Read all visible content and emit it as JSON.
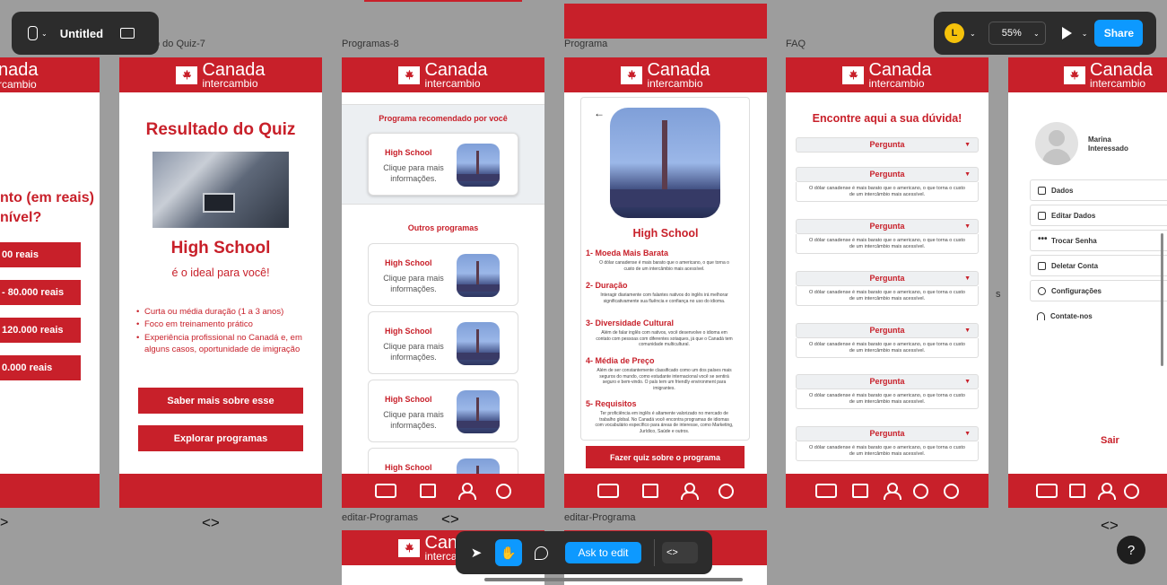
{
  "figma": {
    "file_name": "Untitled",
    "avatar_letter": "L",
    "zoom": "55%",
    "share_label": "Share",
    "ask_to_edit_label": "Ask to edit",
    "help_label": "?"
  },
  "frame_labels": {
    "quiz": "o do Quiz-7",
    "programas": "Programas-8",
    "programa": "Programa",
    "faq": "FAQ",
    "editar_programas": "editar-Programas",
    "editar_programa": "editar-Programa",
    "stray_s": "s"
  },
  "code_markers": {
    "m1": "<>",
    "m2": "<>",
    "m3": "<>",
    "m4": ">"
  },
  "logo": {
    "name": "Canada",
    "sub": "intercambio",
    "partial_name": "nada",
    "partial_sub": "rcambio"
  },
  "left_frame": {
    "question_line1": "nto (em reais)",
    "question_line2": "nível?",
    "options": [
      "00 reais",
      "- 80.000 reais",
      "120.000 reais",
      "0.000 reais"
    ]
  },
  "quiz_result": {
    "title": "Resultado do Quiz",
    "program": "High School",
    "subtitle": "é o ideal para você!",
    "bullets": [
      "Curta ou média duração (1 a 3 anos)",
      "Foco em treinamento prático",
      "Experiência profissional no Canadá e, em alguns casos, oportunidade de imigração"
    ],
    "btn_more": "Saber mais sobre esse",
    "btn_explore": "Explorar programas"
  },
  "programas": {
    "recommended_title": "Programa recomendado por você",
    "others_title": "Outros programas",
    "card_title": "High School",
    "card_desc": "Clique para mais informações."
  },
  "programa": {
    "title": "High School",
    "sections": [
      {
        "h": "1- Moeda Mais Barata",
        "t": "O dólar canadense é mais barato que o americano, o que torna o custo de um intercâmbio mais acessível."
      },
      {
        "h": "2- Duração",
        "t": "Interagir diariamente com falantes nativos do inglês irá melhorar significativamente sua fluência e confiança no uso do idioma."
      },
      {
        "h": "3- Diversidade Cultural",
        "t": "Além de falar inglês com nativos, você desenvolve o idioma em contato com pessoas com diferentes sotaques, já que o Canadá tem comunidade multicultural."
      },
      {
        "h": "4- Média de Preço",
        "t": "Além de ser constantemente classificado como um dos países mais seguros do mundo, como estudante internacional você se sentirá seguro e bem-vindo. O país tem um friendly environment para imigrantes."
      },
      {
        "h": "5- Requisitos",
        "t": "Ter proficiência em inglês é altamente valorizado no mercado de trabalho global. No Canadá você encontra programas de idiomas com vocabulário específico para áreas de interesse, como Marketing, Jurídico, Saúde e outros."
      }
    ],
    "btn": "Fazer quiz sobre o programa"
  },
  "faq": {
    "title": "Encontre aqui a sua dúvida!",
    "question": "Pergunta",
    "answer": "O dólar canadense é mais barato que o americano, o que torna o custo de um intercâmbio mais acessível."
  },
  "profile": {
    "name_line1": "Marina",
    "name_line2": "Interessado",
    "menu": [
      "Dados",
      "Editar Dados",
      "Trocar Senha",
      "Deletar Conta",
      "Configurações",
      "Contate-nos"
    ],
    "logout": "Sair"
  },
  "colors": {
    "brand_red": "#c8202a",
    "figma_blue": "#0d99ff",
    "canvas_bg": "#9d9d9d"
  }
}
